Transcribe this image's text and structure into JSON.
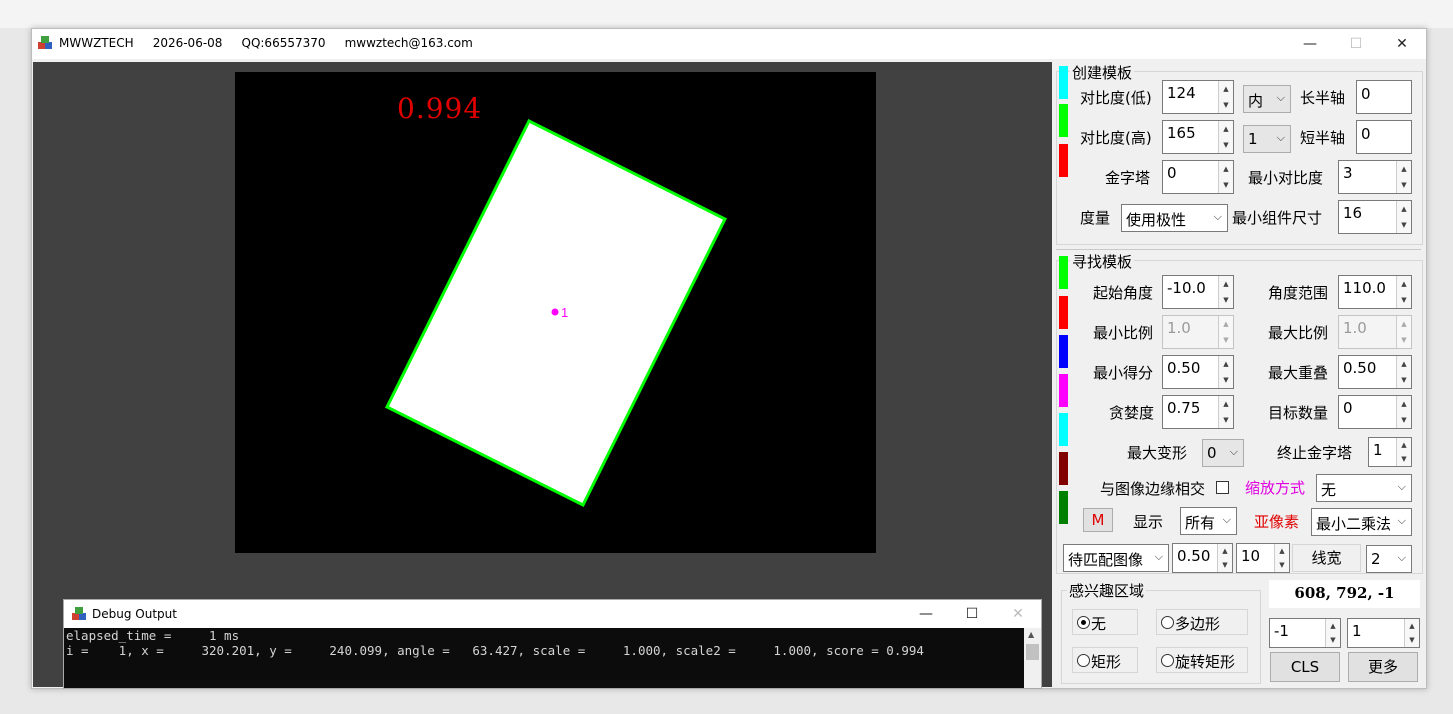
{
  "window": {
    "title": "MWWZTECH     2026-06-08     QQ:66557370     mwwztech@163.com",
    "minimize": "—",
    "maximize": "☐",
    "close": "✕"
  },
  "canvas": {
    "score_text": "0.994",
    "center_label": "1",
    "contour_color": "#00ff00",
    "point_color": "#ff00ff"
  },
  "debug": {
    "title": "Debug Output",
    "minimize": "—",
    "maximize": "☐",
    "close": "✕",
    "line1": "elapsed_time =     1 ms",
    "line2": "i =    1, x =     320.201, y =     240.099, angle =   63.427, scale =     1.000, scale2 =     1.000, score = 0.994"
  },
  "create": {
    "title": "创建模板",
    "contrast_low_label": "对比度(低)",
    "contrast_low": "124",
    "contrast_high_label": "对比度(高)",
    "contrast_high": "165",
    "inner_combo": "内",
    "one_combo": "1",
    "major_axis_label": "长半轴",
    "major_axis": "0",
    "minor_axis_label": "短半轴",
    "minor_axis": "0",
    "pyramid_label": "金字塔",
    "pyramid": "0",
    "min_contrast_label": "最小对比度",
    "min_contrast": "3",
    "metric_label": "度量",
    "metric": "使用极性",
    "min_comp_label": "最小组件尺寸",
    "min_comp": "16"
  },
  "find": {
    "title": "寻找模板",
    "start_angle_label": "起始角度",
    "start_angle": "-10.0",
    "angle_range_label": "角度范围",
    "angle_range": "110.0",
    "min_scale_label": "最小比例",
    "min_scale": "1.0",
    "max_scale_label": "最大比例",
    "max_scale": "1.0",
    "min_score_label": "最小得分",
    "min_score": "0.50",
    "max_overlap_label": "最大重叠",
    "max_overlap": "0.50",
    "greedy_label": "贪婪度",
    "greedy": "0.75",
    "num_targets_label": "目标数量",
    "num_targets": "0",
    "max_deform_label": "最大变形",
    "max_deform": "0",
    "stop_pyramid_label": "终止金字塔",
    "stop_pyramid": "1",
    "edge_intersect_label": "与图像边缘相交",
    "scale_mode_label": "缩放方式",
    "scale_mode": "无",
    "m_button": "M",
    "display_label": "显示",
    "display": "所有",
    "subpixel_label": "亚像素",
    "subpixel": "最小二乘法"
  },
  "bottom": {
    "image_combo": "待匹配图像",
    "value1": "0.50",
    "value2": "10",
    "line_width_label": "线宽",
    "line_width": "2",
    "roi_title": "感兴趣区域",
    "roi_none": "无",
    "roi_polygon": "多边形",
    "roi_rect": "矩形",
    "roi_rot_rect": "旋转矩形",
    "coords": "608, 792, -1",
    "spin_a": "-1",
    "spin_b": "1",
    "cls": "CLS",
    "more": "更多"
  },
  "colors": {
    "swatches_create": [
      "#00ffff",
      "#00ff00",
      "#ff0000"
    ],
    "swatches_find": [
      "#00ff00",
      "#ff0000",
      "#0000ff",
      "#ff00ff",
      "#00ffff",
      "#800000",
      "#008000"
    ],
    "accent_red": "#e00000",
    "accent_magenta": "#e000e0"
  }
}
